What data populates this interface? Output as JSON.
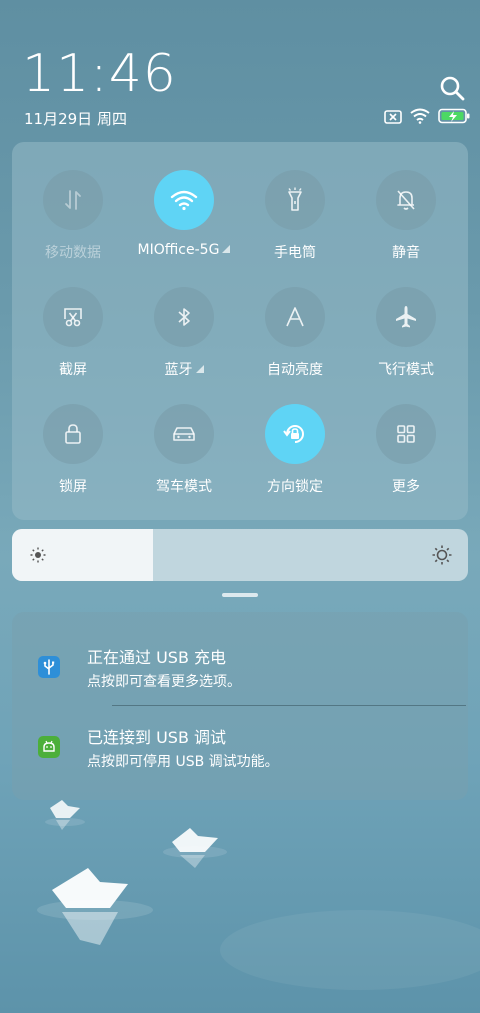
{
  "header": {
    "time": "11:46",
    "date": "11月29日 周四"
  },
  "quick_settings": [
    {
      "label": "移动数据",
      "icon": "mobile-data-icon",
      "active": false,
      "dim": true,
      "arrow": false
    },
    {
      "label": "MIOffice-5G",
      "icon": "wifi-icon",
      "active": true,
      "dim": false,
      "arrow": true
    },
    {
      "label": "手电筒",
      "icon": "flashlight-icon",
      "active": false,
      "dim": false,
      "arrow": false
    },
    {
      "label": "静音",
      "icon": "mute-bell-icon",
      "active": false,
      "dim": false,
      "arrow": false
    },
    {
      "label": "截屏",
      "icon": "screenshot-icon",
      "active": false,
      "dim": false,
      "arrow": false
    },
    {
      "label": "蓝牙",
      "icon": "bluetooth-icon",
      "active": false,
      "dim": false,
      "arrow": true
    },
    {
      "label": "自动亮度",
      "icon": "auto-brightness-icon",
      "active": false,
      "dim": false,
      "arrow": false
    },
    {
      "label": "飞行模式",
      "icon": "airplane-icon",
      "active": false,
      "dim": false,
      "arrow": false
    },
    {
      "label": "锁屏",
      "icon": "lock-icon",
      "active": false,
      "dim": false,
      "arrow": false
    },
    {
      "label": "驾车模式",
      "icon": "car-icon",
      "active": false,
      "dim": false,
      "arrow": false
    },
    {
      "label": "方向锁定",
      "icon": "rotation-lock-icon",
      "active": true,
      "dim": false,
      "arrow": false
    },
    {
      "label": "更多",
      "icon": "grid-icon",
      "active": false,
      "dim": false,
      "arrow": false
    }
  ],
  "brightness": {
    "level": 0.31
  },
  "notifications": [
    {
      "title": "正在通过 USB 充电",
      "body": "点按即可查看更多选项。",
      "icon": "usb-icon",
      "color": "#2e8fd8"
    },
    {
      "title": "已连接到 USB 调试",
      "body": "点按即可停用 USB 调试功能。",
      "icon": "android-debug-icon",
      "color": "#4caf3a"
    }
  ],
  "colors": {
    "accent": "#5fd4f5"
  }
}
